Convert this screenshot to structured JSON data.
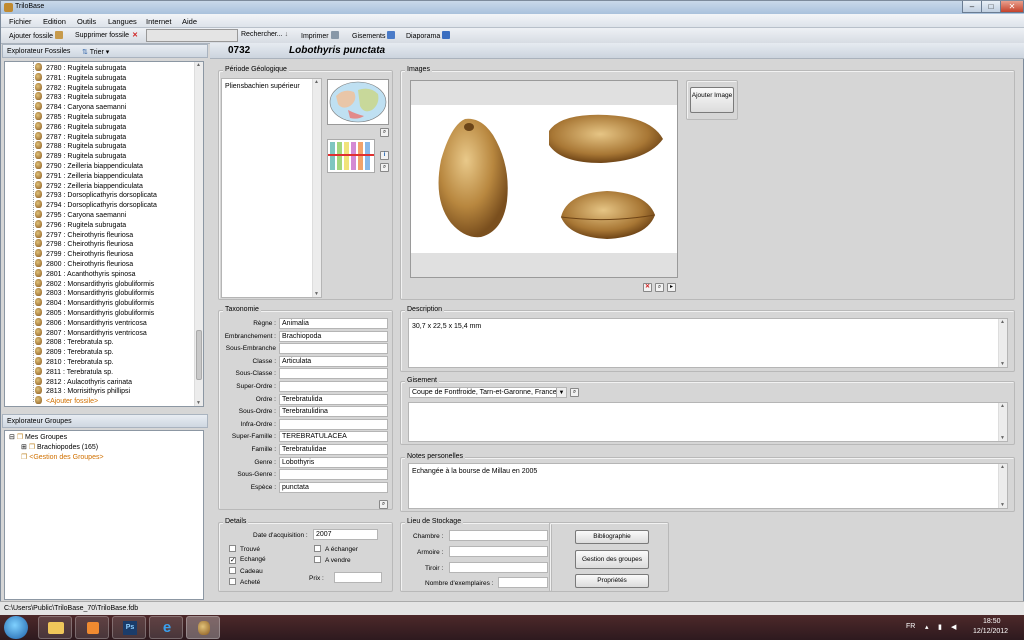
{
  "window": {
    "title": "TriloBase"
  },
  "menu": [
    "Fichier",
    "Edition",
    "Outils",
    "Langues",
    "Internet",
    "Aide"
  ],
  "toolbar": {
    "add_fossil": "Ajouter fossile",
    "delete_fossil": "Supprimer fossile",
    "search": "Rechercher...",
    "print": "Imprimer",
    "deposits": "Gisements",
    "slideshow": "Diaporama"
  },
  "fossil_explorer": {
    "title": "Explorateur Fossiles",
    "sort": "Trier",
    "items": [
      "2780 : Rugitela  subrugata",
      "2781 : Rugitela  subrugata",
      "2782 : Rugitela  subrugata",
      "2783 : Rugitela  subrugata",
      "2784 : Caryona  saemanni",
      "2785 : Rugitela  subrugata",
      "2786 : Rugitela  subrugata",
      "2787 : Rugitela  subrugata",
      "2788 : Rugitela  subrugata",
      "2789 : Rugitela  subrugata",
      "2790 : Zeilleria  biappendiculata",
      "2791 : Zeilleria  biappendiculata",
      "2792 : Zeilleria  biappendiculata",
      "2793 : Dorsoplicathyris  dorsoplicata",
      "2794 : Dorsoplicathyris  dorsoplicata",
      "2795 : Caryona  saemanni",
      "2796 : Rugitela  subrugata",
      "2797 : Cheirothyris  fleuriosa",
      "2798 : Cheirothyris  fleuriosa",
      "2799 : Cheirothyris  fleuriosa",
      "2800 : Cheirothyris  fleuriosa",
      "2801 : Acanthothyris  spinosa",
      "2802 : Monsardithyris  globuliformis",
      "2803 : Monsardithyris  globuliformis",
      "2804 : Monsardithyris  globuliformis",
      "2805 : Monsardithyris  globuliformis",
      "2806 : Monsardithyris  ventricosa",
      "2807 : Monsardithyris  ventricosa",
      "2808 : Terebratula  sp.",
      "2809 : Terebratula  sp.",
      "2810 : Terebratula  sp.",
      "2811 : Terebratula  sp.",
      "2812 : Aulacothyris  carinata",
      "2813 : Morrisithyris  phillipsi"
    ],
    "add_item": "<Ajouter fossile>"
  },
  "group_explorer": {
    "title": "Explorateur Groupes",
    "root": "Mes Groupes",
    "child": "Brachiopodes  (165)",
    "manage": "<Gestion des Groupes>"
  },
  "record": {
    "number": "0732",
    "name": "Lobothyris  punctata"
  },
  "geology": {
    "title": "Période Géologique",
    "value": "Pliensbachien supérieur"
  },
  "images": {
    "title": "Images",
    "add_button": "Ajouter Image"
  },
  "taxonomy": {
    "title": "Taxonomie",
    "fields": [
      {
        "label": "Règne :",
        "value": "Animalia"
      },
      {
        "label": "Embranchement :",
        "value": "Brachiopoda"
      },
      {
        "label": "Sous-Embranche",
        "value": ""
      },
      {
        "label": "Classe :",
        "value": "Articulata"
      },
      {
        "label": "Sous-Classe :",
        "value": ""
      },
      {
        "label": "Super-Ordre :",
        "value": ""
      },
      {
        "label": "Ordre :",
        "value": "Terebratulida"
      },
      {
        "label": "Sous-Ordre :",
        "value": "Terebratulidina"
      },
      {
        "label": "Infra-Ordre :",
        "value": ""
      },
      {
        "label": "Super-Famille :",
        "value": "TEREBRATULACEA"
      },
      {
        "label": "Famille :",
        "value": "Terebratulidae"
      },
      {
        "label": "Genre :",
        "value": "Lobothyris"
      },
      {
        "label": "Sous-Genre :",
        "value": ""
      },
      {
        "label": "Espèce :",
        "value": "punctata"
      }
    ]
  },
  "description": {
    "title": "Description",
    "value": "30,7 x 22,5 x 15,4 mm"
  },
  "deposit": {
    "title": "Gisement",
    "selected": "Coupe de Fontfroide, Tarn-et-Garonne, France"
  },
  "notes": {
    "title": "Notes personelles",
    "value": "Echangée à la bourse de Millau en 2005"
  },
  "details": {
    "title": "Details",
    "acq_label": "Date d'acquisition :",
    "acq_value": "2007",
    "found": "Trouvé",
    "exchanged": "Echangé",
    "gift": "Cadeau",
    "bought": "Acheté",
    "to_exchange": "A échanger",
    "to_sell": "A vendre",
    "price_label": "Prix :"
  },
  "storage": {
    "title": "Lieu de Stockage",
    "room": "Chambre :",
    "cabinet": "Armoire :",
    "drawer": "Tiroir :",
    "count": "Nombre d'exemplaires :"
  },
  "side_buttons": {
    "bibliography": "Bibliographie",
    "groups": "Gestion des groupes",
    "properties": "Propriétés"
  },
  "status": {
    "path": "C:\\Users\\Public\\TriloBase_70\\TriloBase.fdb"
  },
  "taskbar": {
    "lang": "FR",
    "time": "18:50",
    "date": "12/12/2012"
  }
}
